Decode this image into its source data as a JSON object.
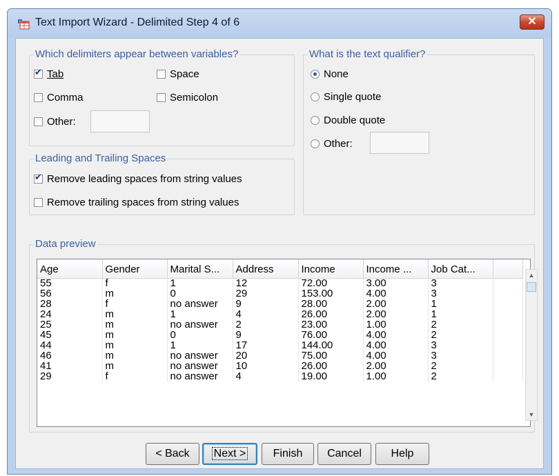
{
  "window": {
    "title": "Text Import Wizard - Delimited Step 4 of 6",
    "close_label": "✕"
  },
  "delimiters": {
    "legend": "Which delimiters appear between variables?",
    "tab": {
      "label": "Tab",
      "checked": true
    },
    "space": {
      "label": "Space",
      "checked": false
    },
    "comma": {
      "label": "Comma",
      "checked": false
    },
    "semicolon": {
      "label": "Semicolon",
      "checked": false
    },
    "other": {
      "label": "Other:",
      "checked": false,
      "value": ""
    }
  },
  "qualifier": {
    "legend": "What is the text qualifier?",
    "none": {
      "label": "None",
      "selected": true
    },
    "single": {
      "label": "Single quote",
      "selected": false
    },
    "double": {
      "label": "Double quote",
      "selected": false
    },
    "other": {
      "label": "Other:",
      "selected": false,
      "value": ""
    }
  },
  "spaces": {
    "legend": "Leading and Trailing Spaces",
    "leading": {
      "label": "Remove leading spaces from string values",
      "checked": true
    },
    "trailing": {
      "label": "Remove trailing spaces from string values",
      "checked": false
    }
  },
  "preview": {
    "legend": "Data preview",
    "columns": [
      "Age",
      "Gender",
      "Marital S...",
      "Address",
      "Income",
      "Income ...",
      "Job Cat..."
    ],
    "rows": [
      [
        "55",
        "f",
        "1",
        "12",
        "72.00",
        "3.00",
        "3"
      ],
      [
        "56",
        "m",
        "0",
        "29",
        "153.00",
        "4.00",
        "3"
      ],
      [
        "28",
        "f",
        "no answer",
        "9",
        "28.00",
        "2.00",
        "1"
      ],
      [
        "24",
        "m",
        "1",
        "4",
        "26.00",
        "2.00",
        "1"
      ],
      [
        "25",
        "m",
        "no answer",
        "2",
        "23.00",
        "1.00",
        "2"
      ],
      [
        "45",
        "m",
        "0",
        "9",
        "76.00",
        "4.00",
        "2"
      ],
      [
        "44",
        "m",
        "1",
        "17",
        "144.00",
        "4.00",
        "3"
      ],
      [
        "46",
        "m",
        "no answer",
        "20",
        "75.00",
        "4.00",
        "3"
      ],
      [
        "41",
        "m",
        "no answer",
        "10",
        "26.00",
        "2.00",
        "2"
      ],
      [
        "29",
        "f",
        "no answer",
        "4",
        "19.00",
        "1.00",
        "2"
      ]
    ]
  },
  "buttons": {
    "back": "< Back",
    "next": "Next >",
    "finish": "Finish",
    "cancel": "Cancel",
    "help": "Help"
  },
  "colors": {
    "legend_text": "#3c5e9e",
    "window_frame": "#bcd1ec",
    "close_button": "#c8452a"
  }
}
